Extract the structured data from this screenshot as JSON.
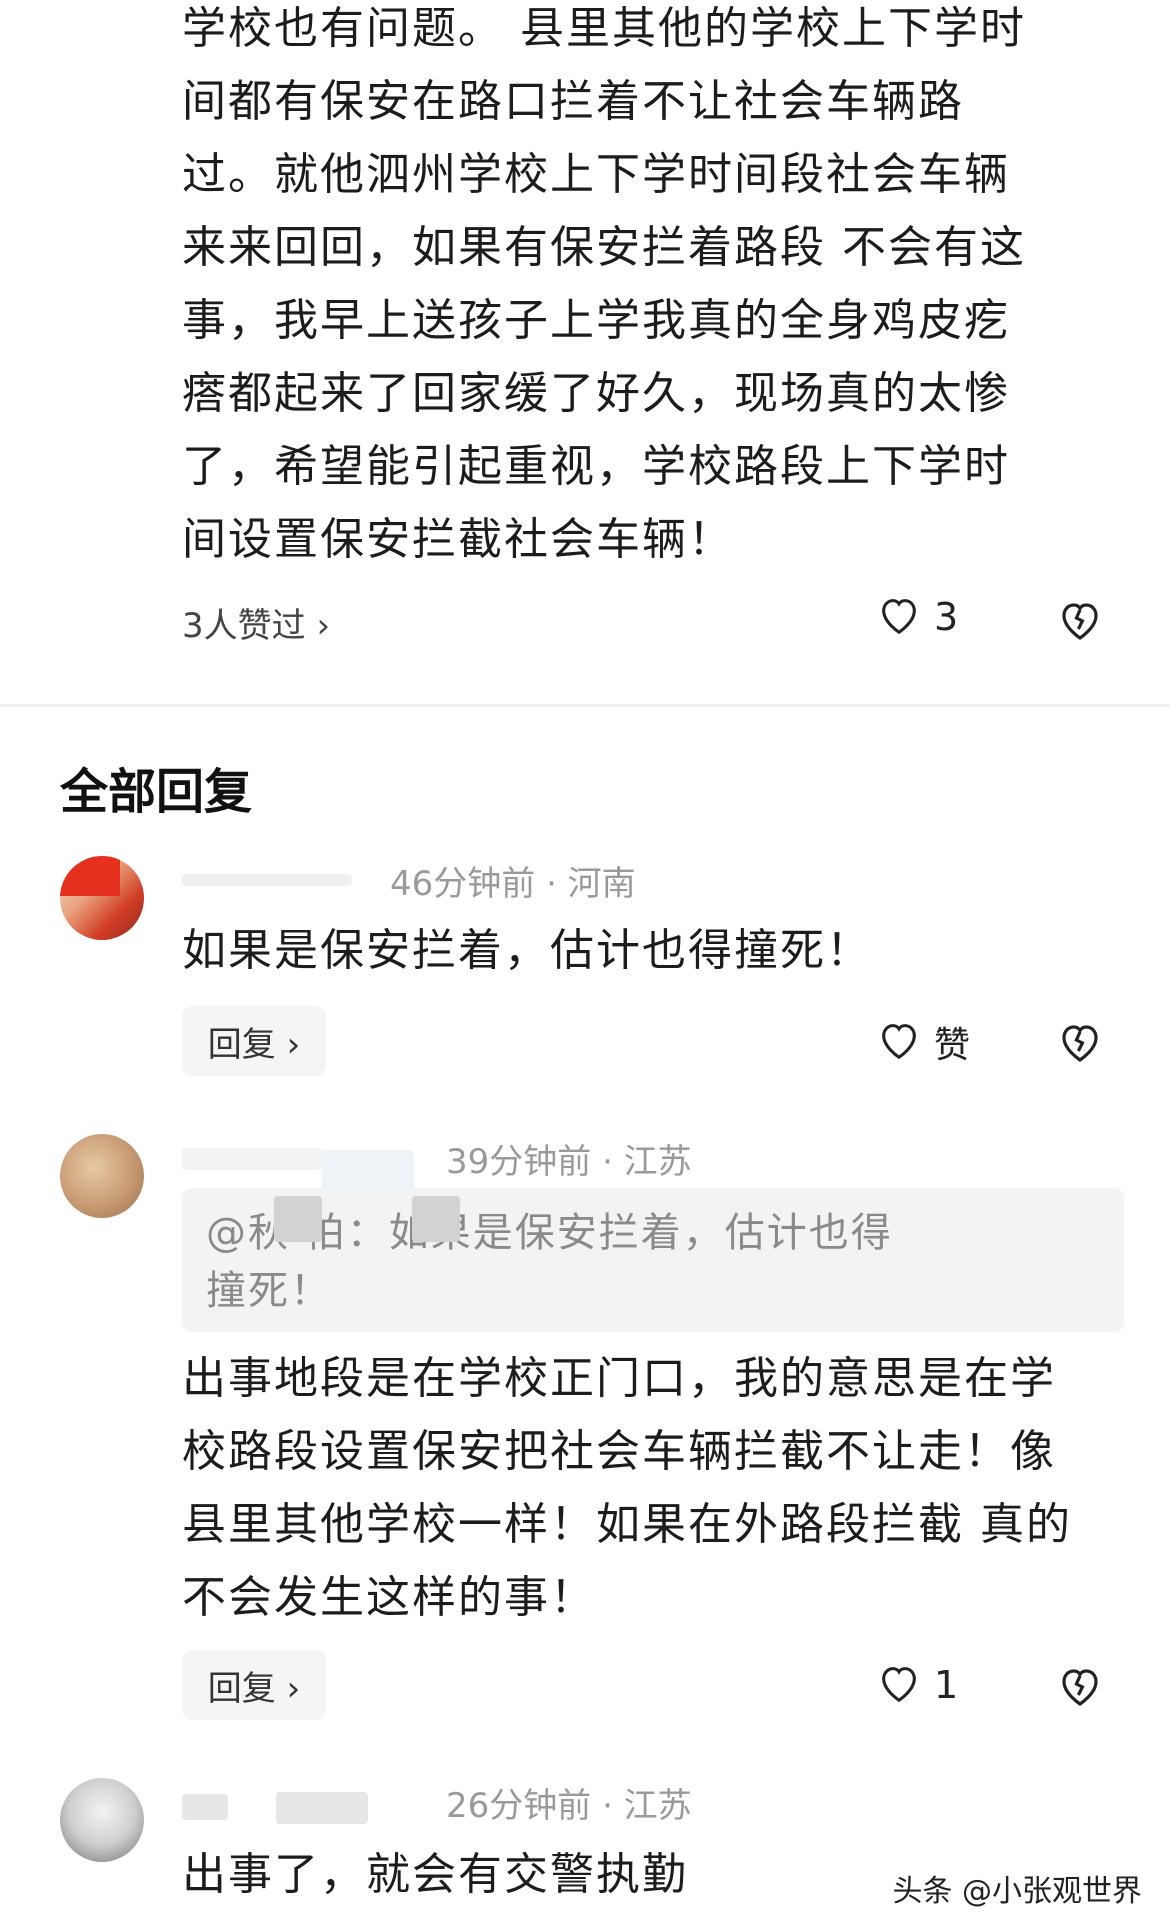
{
  "top_comment": {
    "text": "学校也有问题。 县里其他的学校上下学时\n间都有保安在路口拦着不让社会车辆路\n过。就他泗州学校上下学时间段社会车辆\n来来回回，如果有保安拦着路段 不会有这\n事，我早上送孩子上学我真的全身鸡皮疙\n瘩都起来了回家缓了好久，现场真的太惨\n了，希望能引起重视，学校路段上下学时\n间设置保安拦截社会车辆！",
    "likes_link": "3人赞过 ›",
    "like_count": "3"
  },
  "section_title": "全部回复",
  "replies": [
    {
      "meta": "46分钟前 · 河南",
      "text": "如果是保安拦着，估计也得撞死！",
      "reply_label": "回复 ›",
      "like_label": "赞"
    },
    {
      "meta": "39分钟前 · 江苏",
      "quote": "@秋        柏：如果是保安拦着，估计也得\n撞死！",
      "text": "出事地段是在学校正门口，我的意思是在学\n校路段设置保安把社会车辆拦截不让走！像\n县里其他学校一样！如果在外路段拦截 真的\n不会发生这样的事！",
      "reply_label": "回复 ›",
      "like_count": "1"
    },
    {
      "meta": "26分钟前 · 江苏",
      "text": "出事了，就会有交警执勤"
    }
  ],
  "watermark": "头条 @小张观世界",
  "icons": {
    "like": "heart-icon",
    "dislike": "broken-heart-icon",
    "chevron": "chevron-right-icon"
  }
}
